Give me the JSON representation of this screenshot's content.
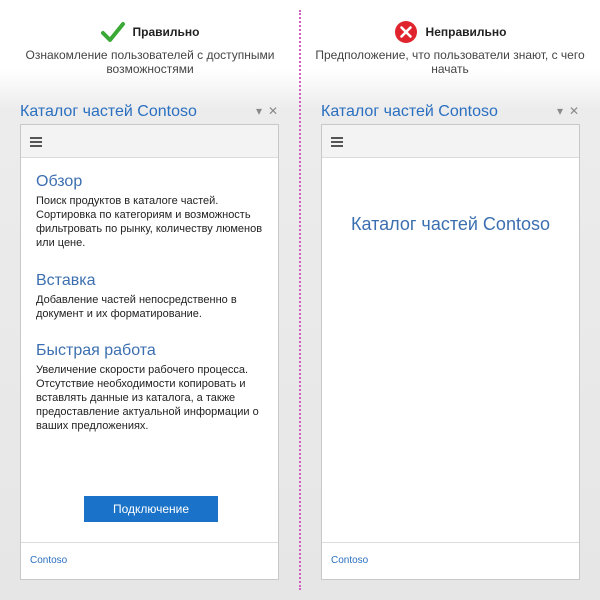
{
  "good": {
    "label": "Правильно",
    "description": "Ознакомление пользователей с доступными возможностями",
    "pane_title": "Каталог частей Contoso",
    "sections": [
      {
        "heading": "Обзор",
        "text": "Поиск продуктов в каталоге частей. Сортировка по категориям и возможность фильтровать по рынку, количеству люменов или цене."
      },
      {
        "heading": "Вставка",
        "text": "Добавление частей непосредственно в документ и их форматирование."
      },
      {
        "heading": "Быстрая работа",
        "text": "Увеличение скорости рабочего процесса. Отсутствие необходимости копировать и вставлять данные из каталога, а также предоставление актуальной информации о ваших предложениях."
      }
    ],
    "connect_label": "Подключение",
    "footer_link": "Contoso"
  },
  "bad": {
    "label": "Неправильно",
    "description": "Предположение, что пользователи знают, с чего начать",
    "pane_title": "Каталог частей Contoso",
    "center_title": "Каталог частей Contoso",
    "footer_link": "Contoso"
  },
  "controls": {
    "dropdown": "▾",
    "close": "✕"
  },
  "colors": {
    "good_icon": "#3aa935",
    "bad_icon": "#e0242e",
    "accent": "#1a73c8",
    "title": "#2a6fc0"
  },
  "icons": {
    "good": "checkmark-icon",
    "bad": "error-x-icon",
    "menu": "hamburger-menu-icon"
  }
}
